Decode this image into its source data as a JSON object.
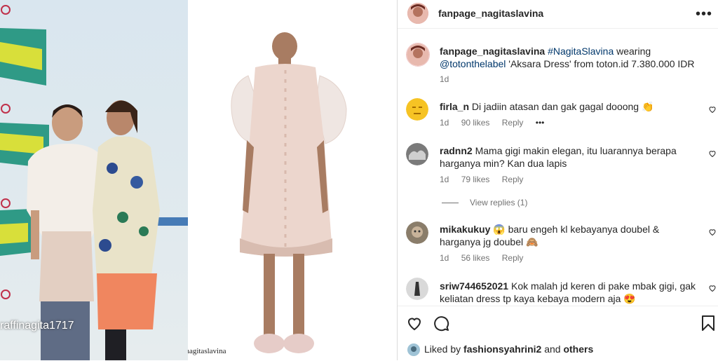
{
  "media": {
    "left_watermark": "raffinagita1717",
    "credit": "@fanpage_nagitaslavina"
  },
  "header": {
    "username": "fanpage_nagitaslavina",
    "more_icon": "more-horizontal-icon"
  },
  "caption": {
    "username": "fanpage_nagitaslavina",
    "hashtag": "#NagitaSlavina",
    "text1": " wearing ",
    "mention": "@totonthelabel",
    "text2": "'Aksara Dress' from toton.id 7.380.000 IDR",
    "time": "1d"
  },
  "comments": [
    {
      "username": "firla_n",
      "text": "Di jadiin atasan dan gak gagal dooong 👏",
      "time": "1d",
      "likes": "90 likes",
      "reply": "Reply",
      "more": "•••"
    },
    {
      "username": "radnn2",
      "text": "Mama gigi makin elegan, itu luarannya berapa harganya min? Kan dua lapis",
      "time": "1d",
      "likes": "79 likes",
      "reply": "Reply",
      "view_replies": "View replies (1)"
    },
    {
      "username": "mikakukuy",
      "text": "😱 baru engeh kl kebayanya doubel & harganya jg doubel 🙈",
      "time": "1d",
      "likes": "56 likes",
      "reply": "Reply"
    },
    {
      "username": "sriw744652021",
      "text": "Kok malah jd keren di pake mbak gigi, gak keliatan dress tp kaya kebaya modern aja 😍"
    }
  ],
  "footer": {
    "liked_by_prefix": "Liked by ",
    "liked_by_user": "fashionsyahrini2",
    "liked_by_and": " and ",
    "liked_by_others": "others"
  }
}
